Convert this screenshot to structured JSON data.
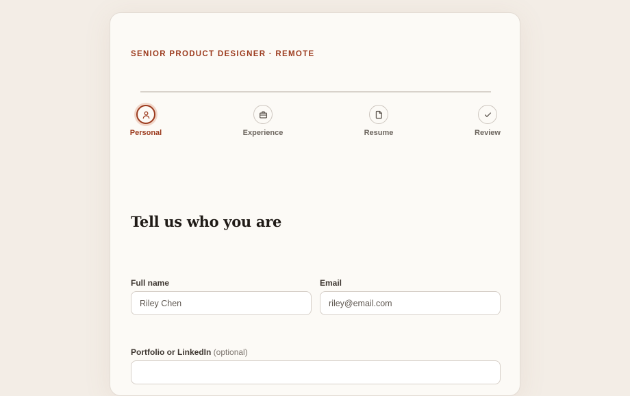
{
  "job": {
    "eyebrow": "SENIOR PRODUCT DESIGNER · REMOTE"
  },
  "steps": [
    {
      "label": "Personal",
      "icon": "person-icon",
      "active": true
    },
    {
      "label": "Experience",
      "icon": "briefcase-icon",
      "active": false
    },
    {
      "label": "Resume",
      "icon": "document-icon",
      "active": false
    },
    {
      "label": "Review",
      "icon": "check-icon",
      "active": false
    }
  ],
  "form": {
    "heading": "Tell us who you are",
    "full_name": {
      "label": "Full name",
      "value": "Riley Chen"
    },
    "email": {
      "label": "Email",
      "value": "riley@email.com"
    },
    "portfolio": {
      "label": "Portfolio or LinkedIn",
      "optional": "(optional)"
    }
  },
  "colors": {
    "accent": "#9b3a1d",
    "background": "#f3ede6",
    "card": "#fcfaf6"
  }
}
